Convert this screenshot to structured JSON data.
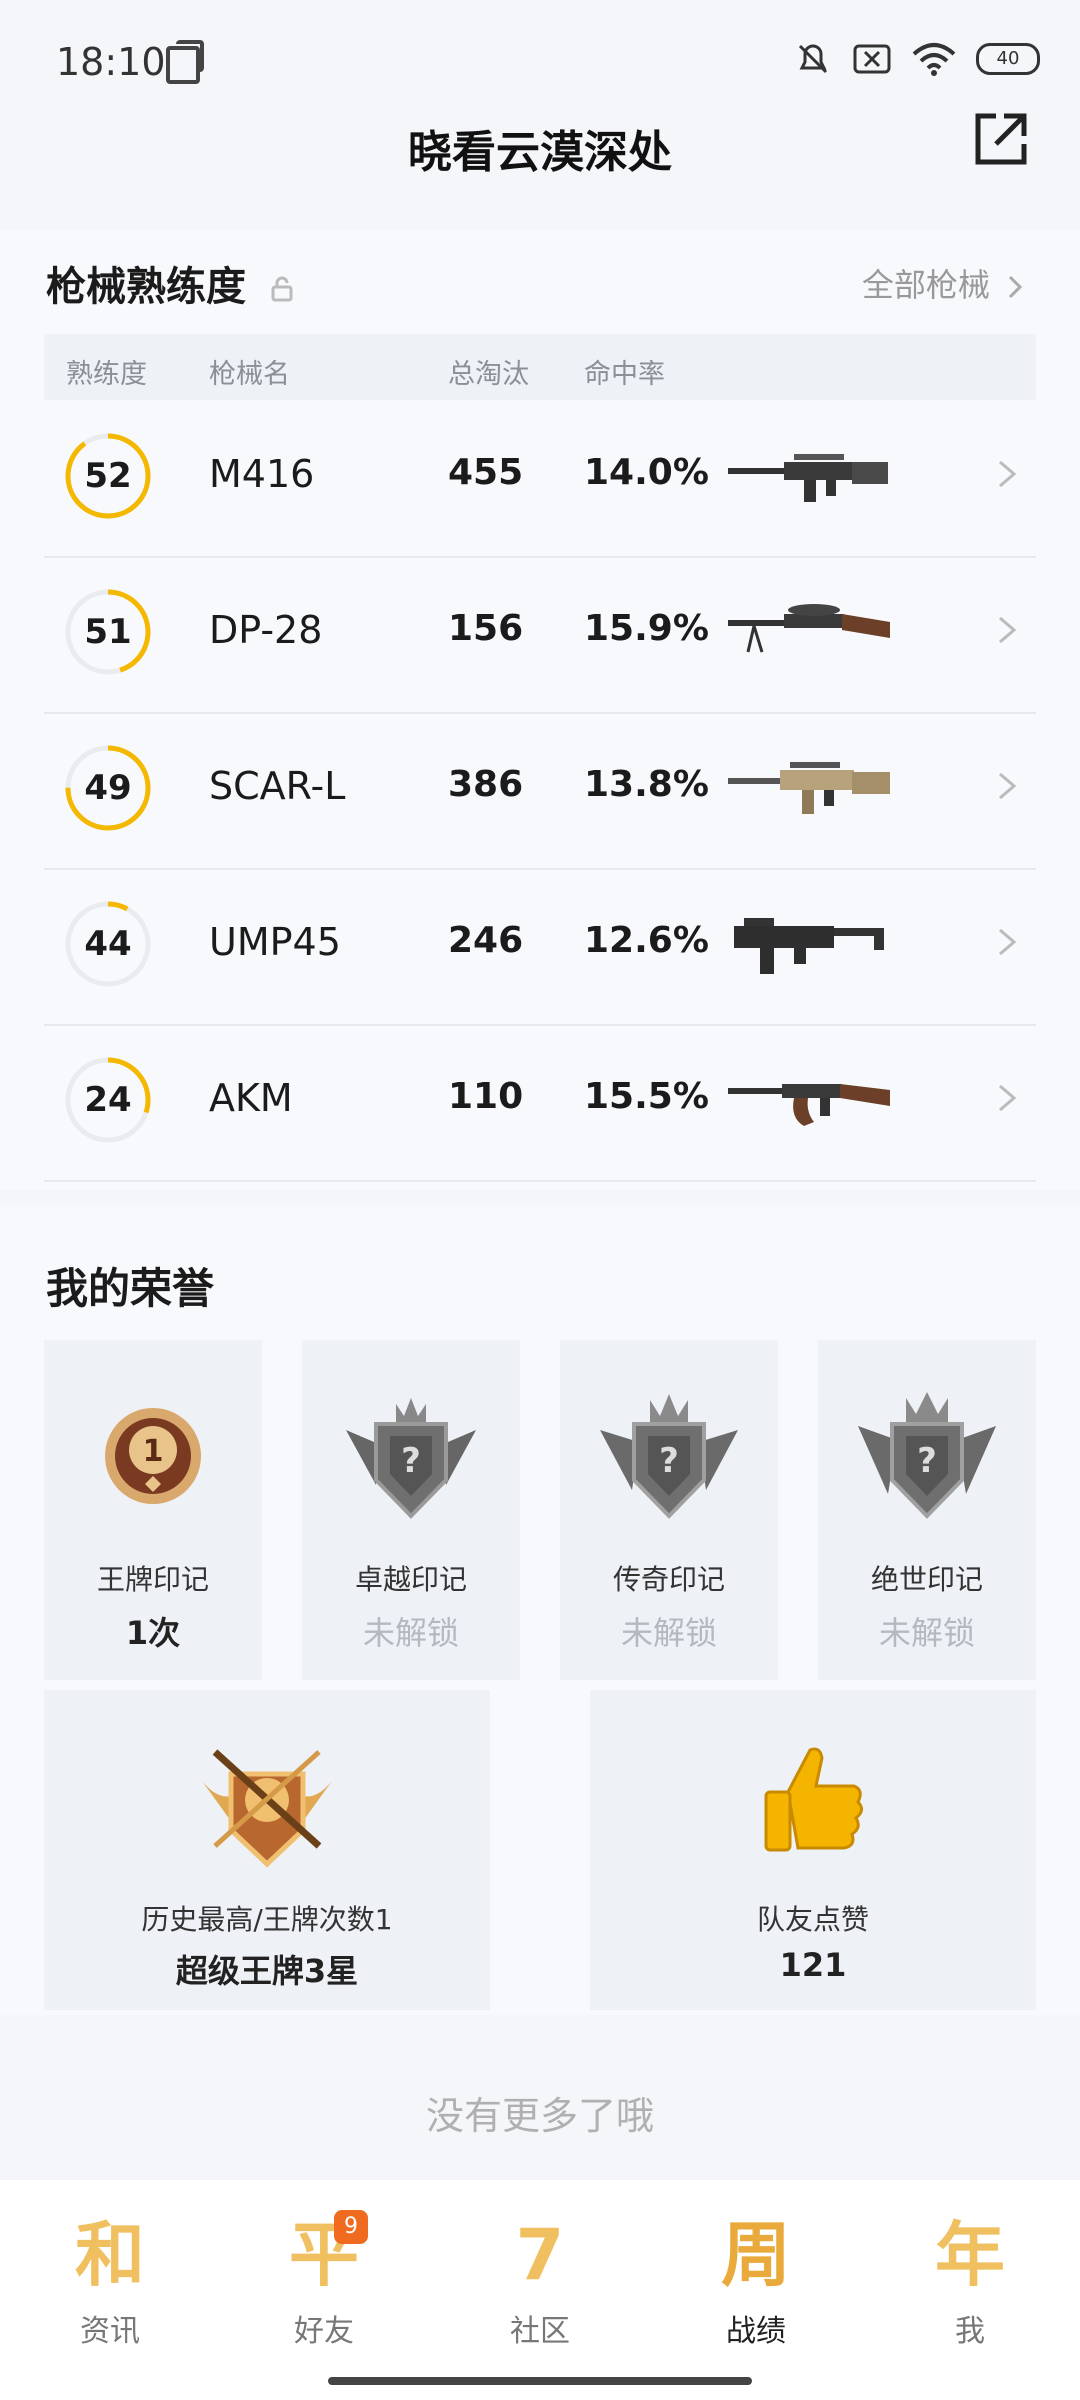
{
  "status": {
    "time": "18:10",
    "battery": "40"
  },
  "header": {
    "title": "晓看云漠深处"
  },
  "guns": {
    "title": "枪械熟练度",
    "all_link": "全部枪械",
    "columns": [
      "熟练度",
      "枪械名",
      "总淘汰",
      "命中率"
    ],
    "rows": [
      {
        "level": "52",
        "progress": 0.9,
        "name": "M416",
        "kills": "455",
        "accuracy": "14.0%"
      },
      {
        "level": "51",
        "progress": 0.45,
        "name": "DP-28",
        "kills": "156",
        "accuracy": "15.9%"
      },
      {
        "level": "49",
        "progress": 0.75,
        "name": "SCAR-L",
        "kills": "386",
        "accuracy": "13.8%"
      },
      {
        "level": "44",
        "progress": 0.08,
        "name": "UMP45",
        "kills": "246",
        "accuracy": "12.6%"
      },
      {
        "level": "24",
        "progress": 0.3,
        "name": "AKM",
        "kills": "110",
        "accuracy": "15.5%"
      }
    ]
  },
  "honor": {
    "title": "我的荣誉",
    "badges": [
      {
        "label": "王牌印记",
        "value": "1次"
      },
      {
        "label": "卓越印记",
        "value": "未解锁"
      },
      {
        "label": "传奇印记",
        "value": "未解锁"
      },
      {
        "label": "绝世印记",
        "value": "未解锁"
      }
    ],
    "history": {
      "label": "历史最高/王牌次数1",
      "value": "超级王牌3星"
    },
    "likes": {
      "label": "队友点赞",
      "value": "121"
    }
  },
  "footer": {
    "no_more": "没有更多了哦"
  },
  "tabs": [
    {
      "icon_char": "和",
      "label": "资讯"
    },
    {
      "icon_char": "平",
      "label": "好友",
      "badge": "9"
    },
    {
      "icon_char": "7",
      "label": "社区"
    },
    {
      "icon_char": "周",
      "label": "战绩"
    },
    {
      "icon_char": "年",
      "label": "我"
    }
  ],
  "colors": {
    "accent": "#f5b800",
    "ring_bg": "#e9ebef"
  }
}
